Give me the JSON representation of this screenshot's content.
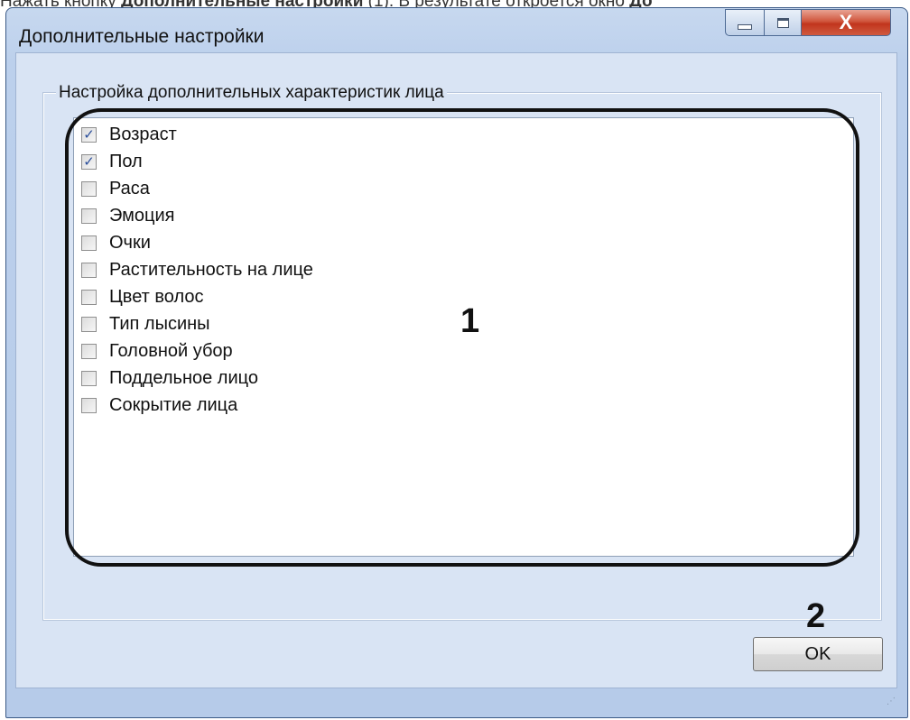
{
  "page": {
    "top_text_prefix": "Нажать кнопку",
    "top_text_bold": "Дополнительные настройки",
    "top_text_suffix": "(1). В результате откроется окно",
    "top_text_bold2": "До"
  },
  "window": {
    "title": "Дополнительные настройки",
    "close_glyph": "X"
  },
  "group": {
    "label": "Настройка дополнительных характеристик лица",
    "items": [
      {
        "label": "Возраст",
        "checked": true
      },
      {
        "label": "Пол",
        "checked": true
      },
      {
        "label": "Раса",
        "checked": false
      },
      {
        "label": "Эмоция",
        "checked": false
      },
      {
        "label": "Очки",
        "checked": false
      },
      {
        "label": "Растительность на лице",
        "checked": false
      },
      {
        "label": "Цвет волос",
        "checked": false
      },
      {
        "label": "Тип лысины",
        "checked": false
      },
      {
        "label": "Головной убор",
        "checked": false
      },
      {
        "label": "Поддельное лицо",
        "checked": false
      },
      {
        "label": "Сокрытие лица",
        "checked": false
      }
    ]
  },
  "annotations": {
    "marker1": "1",
    "marker2": "2"
  },
  "buttons": {
    "ok_label": "OK"
  }
}
